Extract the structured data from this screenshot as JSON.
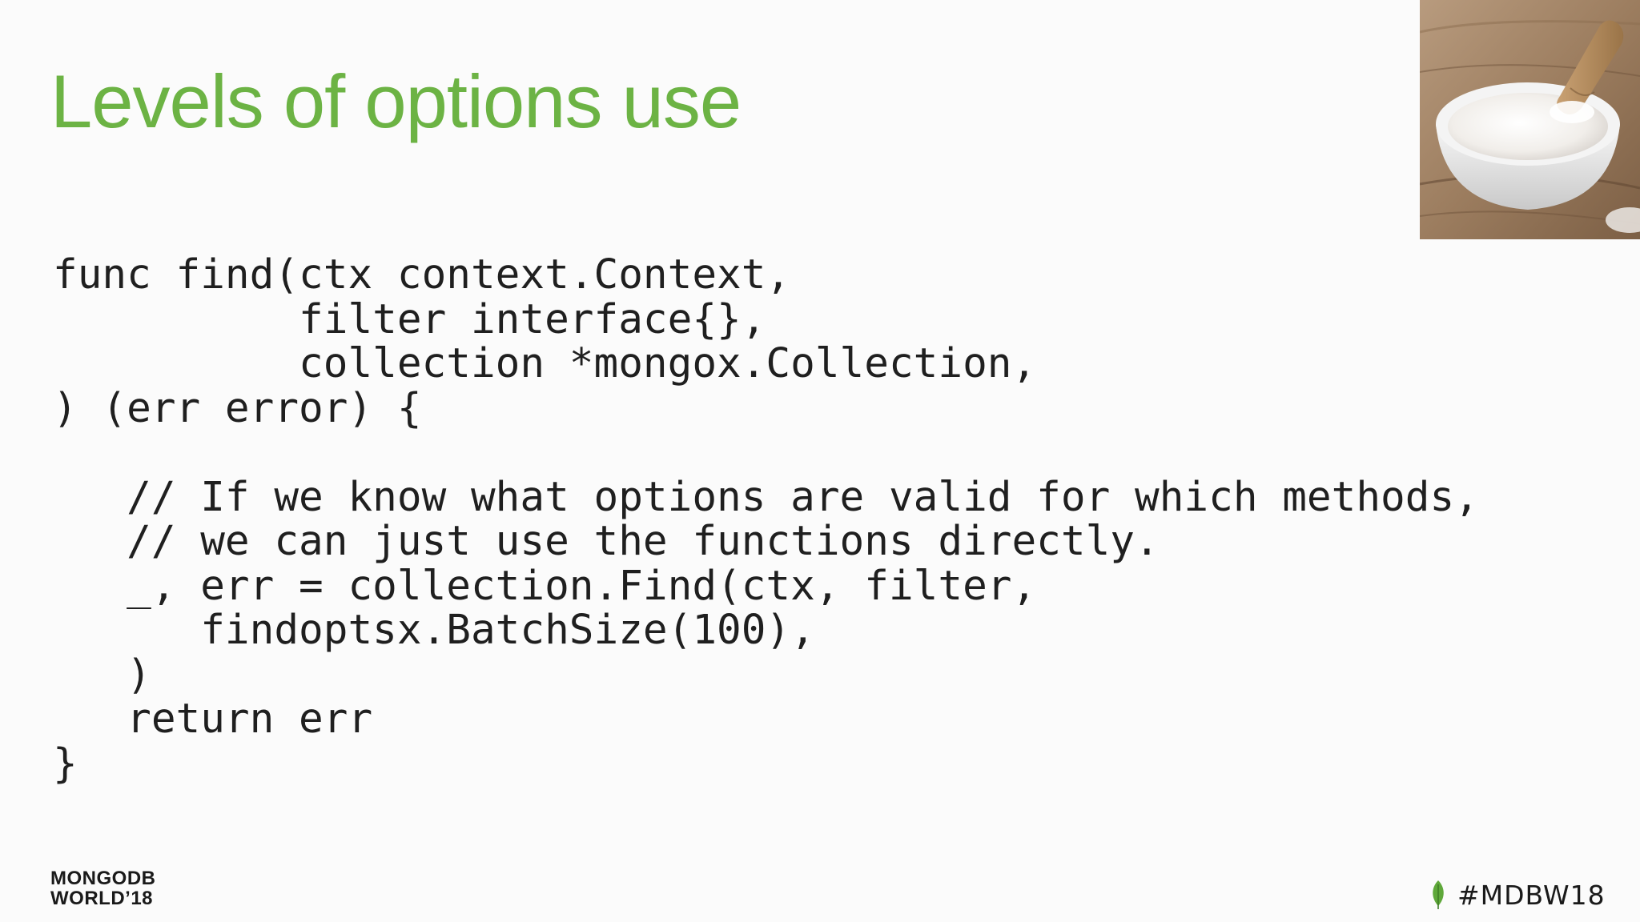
{
  "slide": {
    "title": "Levels of options use",
    "code_lines": [
      "func find(ctx context.Context,",
      "          filter interface{},",
      "          collection *mongox.Collection,",
      ") (err error) {",
      "",
      "   // If we know what options are valid for which methods,",
      "   // we can just use the functions directly.",
      "   _, err = collection.Find(ctx, filter,",
      "      findoptsx.BatchSize(100),",
      "   )",
      "   return err",
      "}"
    ],
    "logo": {
      "line1": "MONGODB",
      "line2": "WORLD’18"
    },
    "hashtag": "#MDBW18",
    "accent_color": "#6cb344",
    "icons": {
      "leaf": "mongodb-leaf-icon",
      "photo": "bowl-of-baking-soda-with-wooden-scoop"
    }
  }
}
